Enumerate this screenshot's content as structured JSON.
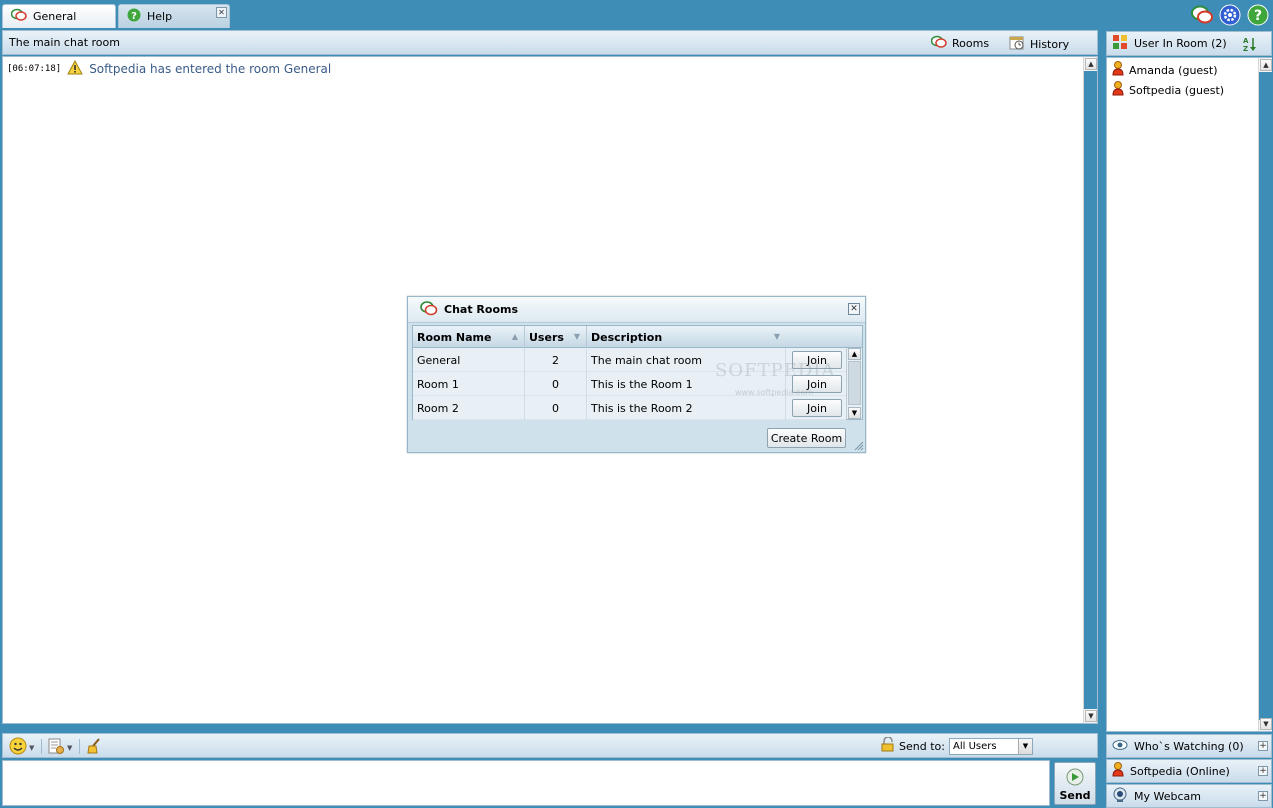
{
  "tabs": [
    {
      "label": "General",
      "active": true,
      "icon": "chat-bubbles-icon"
    },
    {
      "label": "Help",
      "active": false,
      "icon": "help-icon"
    }
  ],
  "top_icons": [
    "chat-bubbles-icon",
    "settings-icon",
    "help-icon"
  ],
  "chat": {
    "room_title": "The main chat room",
    "rooms_label": "Rooms",
    "history_label": "History",
    "messages": [
      {
        "time": "[06:07:18]",
        "icon": "warning-icon",
        "text": "Softpedia has entered the room General"
      }
    ]
  },
  "bottom": {
    "send_to_label": "Send to:",
    "send_to_value": "All Users",
    "send_label": "Send"
  },
  "users_panel": {
    "title": "User In Room (2)",
    "users": [
      {
        "name": "Amanda (guest)"
      },
      {
        "name": "Softpedia (guest)"
      }
    ],
    "sections": [
      {
        "label": "Who`s Watching (0)",
        "icon": "eye-icon"
      },
      {
        "label": "Softpedia (Online)",
        "icon": "user-icon"
      },
      {
        "label": "My Webcam",
        "icon": "webcam-icon"
      }
    ]
  },
  "dialog": {
    "title": "Chat Rooms",
    "columns": [
      "Room Name",
      "Users",
      "Description"
    ],
    "rows": [
      {
        "name": "General",
        "users": "2",
        "description": "The main chat room",
        "action": "Join"
      },
      {
        "name": "Room 1",
        "users": "0",
        "description": "This is the Room 1",
        "action": "Join"
      },
      {
        "name": "Room 2",
        "users": "0",
        "description": "This is the Room 2",
        "action": "Join"
      }
    ],
    "create_label": "Create Room",
    "watermark": "SOFTPEDIA",
    "watermark_url": "www.softpedia.com"
  },
  "colors": {
    "background": "#3e8db7",
    "accent_text": "#3a5c87"
  }
}
